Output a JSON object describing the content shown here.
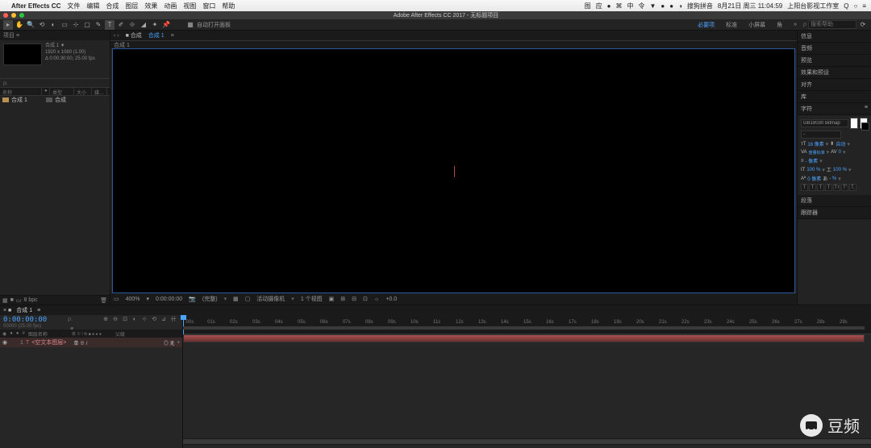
{
  "mac": {
    "app": "After Effects CC",
    "menus": [
      "文件",
      "编辑",
      "合成",
      "图层",
      "效果",
      "动画",
      "视图",
      "窗口",
      "帮助"
    ],
    "status_right": [
      "图",
      "应",
      "●",
      "⌘",
      "中",
      "令",
      "▼",
      "●",
      "●",
      "◑",
      "搜狗拼音",
      "8月21日 周三  11:04:59",
      "上阳台影视工作室",
      "Q",
      "○",
      "≡"
    ]
  },
  "titlebar": {
    "title": "Adobe After Effects CC 2017 - 无标题项目"
  },
  "toolbar": {
    "snap_label": "自动打开面板",
    "workspaces": [
      "必要项",
      "标准",
      "小屏幕",
      "角",
      "»"
    ],
    "search_placeholder": "搜索帮助"
  },
  "project": {
    "panel_title": "项目 ≡",
    "item_name": "合成 1 ▼",
    "dims": "1920 x 1080 (1.00)",
    "dur": "Δ 0:00:30:00, 25.00 fps",
    "search_ph": "ρ.",
    "cols": [
      "名称",
      "●",
      "类型",
      "大小",
      "媒…"
    ],
    "row_name": "合成 1",
    "row_type": "合成",
    "bpc": "8 bpc"
  },
  "comp": {
    "tabs_prefix": "■ 合成",
    "tab_name": "合成 1",
    "flow": "合成 1"
  },
  "viewer": {
    "zoom": "400%",
    "time": "0:00:00:00",
    "quality": "(完整)",
    "camera": "活动摄像机",
    "views": "1 个视图",
    "exposure": "+0.0"
  },
  "right": {
    "sections": [
      "信息",
      "音频",
      "预览",
      "效果和预设",
      "对齐",
      "库"
    ],
    "char_title": "字符",
    "font": "GB18030 Bitmap",
    "style": "-",
    "size": "16 像素",
    "leading": "自动",
    "kerning": "度量标准",
    "tracking": "0",
    "stroke": "- 像素",
    "vscale": "100 %",
    "hscale": "100 %",
    "baseline": "0 像素",
    "tsume": "- %",
    "style_btns": [
      "T",
      "T",
      "T",
      "T",
      "Tт",
      "T′",
      "T,"
    ],
    "para": "段落",
    "track": "跟踪器"
  },
  "timeline": {
    "tab_prefix": "× ■",
    "tab_name": "合成 1",
    "timecode": "0:00:00:00",
    "sub": "00000 (25.00 fps)",
    "search_ph": "ρ.",
    "layer_head": [
      "◉",
      "●",
      "●",
      "#",
      "图层名称",
      "单 ※ \\ fx ■ ● ● ●",
      "父级"
    ],
    "layer_num": "1",
    "layer_name": "<空文本图层>",
    "layer_switches": "单 ※ /",
    "parent": "◎ 无",
    "ticks": [
      ":00s",
      "01s",
      "02s",
      "03s",
      "04s",
      "05s",
      "06s",
      "07s",
      "08s",
      "09s",
      "10s",
      "11s",
      "12s",
      "13s",
      "14s",
      "15s",
      "16s",
      "17s",
      "18s",
      "19s",
      "20s",
      "21s",
      "22s",
      "23s",
      "24s",
      "25s",
      "26s",
      "27s",
      "28s",
      "29s"
    ]
  },
  "watermark": "豆频"
}
